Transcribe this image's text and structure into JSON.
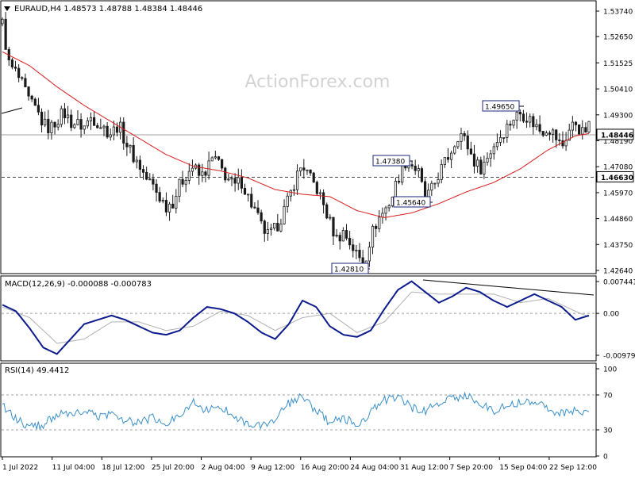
{
  "colors": {
    "candle": "#1a1a1a",
    "sma": "#d81e1e",
    "macd": "#0b1a8c",
    "signal": "#b0b0b0",
    "rsi": "#3a8fc8",
    "grid": "#a0a0a0",
    "label_border": "#1a237e",
    "price_box": "#ffffff"
  },
  "panels": {
    "main": {
      "header": "EURAUD,H4  1.48573 1.48788 1.48384 1.48446",
      "watermark": "ActionForex.com",
      "y_ticks": [
        "1.53740",
        "1.52650",
        "1.51525",
        "1.50410",
        "1.49300",
        "1.48190",
        "1.47080",
        "1.45970",
        "1.44860",
        "1.43750",
        "1.42640"
      ],
      "current_price": "1.48446",
      "support_level": "1.46630",
      "annotations": [
        "1.49650",
        "1.47380",
        "1.45640",
        "1.42810"
      ]
    },
    "macd": {
      "header": "MACD(12,26,9) -0.000088 -0.000783",
      "y_ticks": [
        "0.007441",
        "0.00",
        "-0.009794"
      ]
    },
    "rsi": {
      "header": "RSI(14) 49.4412",
      "y_ticks": [
        "100",
        "70",
        "30",
        "0"
      ]
    },
    "x_ticks": [
      "1 Jul 2022",
      "11 Jul 04:00",
      "18 Jul 12:00",
      "25 Jul 20:00",
      "2 Aug 04:00",
      "9 Aug 12:00",
      "16 Aug 20:00",
      "24 Aug 04:00",
      "31 Aug 12:00",
      "7 Sep 20:00",
      "15 Sep 04:00",
      "22 Sep 12:00"
    ]
  },
  "chart_data": {
    "type": "candlestick",
    "symbol": "EURAUD",
    "timeframe": "H4",
    "ylim": [
      1.4264,
      1.5374
    ],
    "price_path": [
      [
        0,
        1.532
      ],
      [
        1,
        1.514
      ],
      [
        2,
        1.511
      ],
      [
        3,
        1.505
      ],
      [
        4,
        1.498
      ],
      [
        5,
        1.495
      ],
      [
        6,
        1.489
      ],
      [
        7,
        1.487
      ],
      [
        8,
        1.491
      ],
      [
        9,
        1.494
      ],
      [
        10,
        1.49
      ],
      [
        11,
        1.489
      ],
      [
        12,
        1.488
      ],
      [
        13,
        1.492
      ],
      [
        14,
        1.49
      ],
      [
        15,
        1.487
      ],
      [
        16,
        1.485
      ],
      [
        17,
        1.489
      ],
      [
        18,
        1.482
      ],
      [
        19,
        1.476
      ],
      [
        20,
        1.472
      ],
      [
        21,
        1.466
      ],
      [
        22,
        1.463
      ],
      [
        23,
        1.458
      ],
      [
        24,
        1.454
      ],
      [
        25,
        1.456
      ],
      [
        26,
        1.463
      ],
      [
        27,
        1.468
      ],
      [
        28,
        1.471
      ],
      [
        29,
        1.466
      ],
      [
        30,
        1.47
      ],
      [
        31,
        1.475
      ],
      [
        32,
        1.47
      ],
      [
        33,
        1.466
      ],
      [
        34,
        1.462
      ],
      [
        35,
        1.465
      ],
      [
        36,
        1.458
      ],
      [
        37,
        1.452
      ],
      [
        38,
        1.445
      ],
      [
        39,
        1.441
      ],
      [
        40,
        1.444
      ],
      [
        41,
        1.45
      ],
      [
        42,
        1.457
      ],
      [
        43,
        1.466
      ],
      [
        44,
        1.472
      ],
      [
        45,
        1.466
      ],
      [
        46,
        1.462
      ],
      [
        47,
        1.455
      ],
      [
        48,
        1.447
      ],
      [
        49,
        1.44
      ],
      [
        50,
        1.443
      ],
      [
        51,
        1.438
      ],
      [
        52,
        1.433
      ],
      [
        53,
        1.429
      ],
      [
        54,
        1.441
      ],
      [
        55,
        1.448
      ],
      [
        56,
        1.452
      ],
      [
        57,
        1.457
      ],
      [
        58,
        1.466
      ],
      [
        59,
        1.473
      ],
      [
        60,
        1.472
      ],
      [
        61,
        1.468
      ],
      [
        62,
        1.457
      ],
      [
        63,
        1.461
      ],
      [
        64,
        1.468
      ],
      [
        65,
        1.473
      ],
      [
        66,
        1.479
      ],
      [
        67,
        1.486
      ],
      [
        68,
        1.481
      ],
      [
        69,
        1.474
      ],
      [
        70,
        1.47
      ],
      [
        71,
        1.474
      ],
      [
        72,
        1.48
      ],
      [
        73,
        1.484
      ],
      [
        74,
        1.488
      ],
      [
        75,
        1.492
      ],
      [
        76,
        1.494
      ],
      [
        77,
        1.492
      ],
      [
        78,
        1.489
      ],
      [
        79,
        1.486
      ],
      [
        80,
        1.488
      ],
      [
        81,
        1.484
      ],
      [
        82,
        1.479
      ],
      [
        83,
        1.486
      ],
      [
        84,
        1.49
      ],
      [
        85,
        1.485
      ],
      [
        86,
        1.488
      ]
    ],
    "sma_path": [
      [
        0,
        1.52
      ],
      [
        4,
        1.514
      ],
      [
        8,
        1.505
      ],
      [
        12,
        1.497
      ],
      [
        16,
        1.49
      ],
      [
        20,
        1.483
      ],
      [
        24,
        1.476
      ],
      [
        28,
        1.471
      ],
      [
        32,
        1.469
      ],
      [
        36,
        1.466
      ],
      [
        40,
        1.461
      ],
      [
        44,
        1.459
      ],
      [
        48,
        1.458
      ],
      [
        52,
        1.452
      ],
      [
        56,
        1.449
      ],
      [
        60,
        1.451
      ],
      [
        64,
        1.455
      ],
      [
        68,
        1.46
      ],
      [
        72,
        1.464
      ],
      [
        76,
        1.47
      ],
      [
        80,
        1.478
      ],
      [
        84,
        1.484
      ],
      [
        86,
        1.485
      ]
    ],
    "macd_path": [
      [
        0,
        0.002
      ],
      [
        2,
        0.0005
      ],
      [
        4,
        -0.0035
      ],
      [
        6,
        -0.008
      ],
      [
        8,
        -0.0095
      ],
      [
        10,
        -0.006
      ],
      [
        12,
        -0.0025
      ],
      [
        14,
        -0.0015
      ],
      [
        16,
        -0.0005
      ],
      [
        18,
        -0.0015
      ],
      [
        20,
        -0.003
      ],
      [
        22,
        -0.0045
      ],
      [
        24,
        -0.005
      ],
      [
        26,
        -0.004
      ],
      [
        28,
        -0.001
      ],
      [
        30,
        0.0015
      ],
      [
        32,
        0.001
      ],
      [
        34,
        0.0
      ],
      [
        36,
        -0.002
      ],
      [
        38,
        -0.0045
      ],
      [
        40,
        -0.006
      ],
      [
        42,
        -0.0025
      ],
      [
        44,
        0.003
      ],
      [
        46,
        0.0015
      ],
      [
        48,
        -0.003
      ],
      [
        50,
        -0.005
      ],
      [
        52,
        -0.0055
      ],
      [
        54,
        -0.004
      ],
      [
        56,
        0.001
      ],
      [
        58,
        0.0055
      ],
      [
        60,
        0.0075
      ],
      [
        62,
        0.005
      ],
      [
        64,
        0.0025
      ],
      [
        66,
        0.004
      ],
      [
        68,
        0.006
      ],
      [
        70,
        0.005
      ],
      [
        72,
        0.003
      ],
      [
        74,
        0.0015
      ],
      [
        76,
        0.003
      ],
      [
        78,
        0.0045
      ],
      [
        80,
        0.003
      ],
      [
        82,
        0.0015
      ],
      [
        84,
        -0.0015
      ],
      [
        86,
        -0.0005
      ]
    ],
    "signal_path": [
      [
        0,
        0.0015
      ],
      [
        4,
        -0.001
      ],
      [
        8,
        -0.007
      ],
      [
        12,
        -0.006
      ],
      [
        16,
        -0.002
      ],
      [
        20,
        -0.002
      ],
      [
        24,
        -0.004
      ],
      [
        28,
        -0.003
      ],
      [
        32,
        0.0005
      ],
      [
        36,
        -0.0005
      ],
      [
        40,
        -0.004
      ],
      [
        44,
        -0.001
      ],
      [
        48,
        0.0
      ],
      [
        52,
        -0.0045
      ],
      [
        56,
        -0.002
      ],
      [
        60,
        0.005
      ],
      [
        64,
        0.0045
      ],
      [
        68,
        0.0045
      ],
      [
        72,
        0.0045
      ],
      [
        76,
        0.0025
      ],
      [
        80,
        0.0035
      ],
      [
        84,
        0.0005
      ],
      [
        86,
        -0.0008
      ]
    ],
    "rsi_path": [
      [
        0,
        58
      ],
      [
        2,
        42
      ],
      [
        4,
        33
      ],
      [
        6,
        36
      ],
      [
        8,
        48
      ],
      [
        10,
        46
      ],
      [
        12,
        52
      ],
      [
        14,
        45
      ],
      [
        16,
        49
      ],
      [
        18,
        40
      ],
      [
        20,
        38
      ],
      [
        22,
        44
      ],
      [
        24,
        35
      ],
      [
        26,
        48
      ],
      [
        28,
        62
      ],
      [
        30,
        52
      ],
      [
        32,
        56
      ],
      [
        34,
        47
      ],
      [
        36,
        36
      ],
      [
        38,
        34
      ],
      [
        40,
        42
      ],
      [
        42,
        60
      ],
      [
        44,
        68
      ],
      [
        46,
        52
      ],
      [
        48,
        38
      ],
      [
        50,
        44
      ],
      [
        52,
        35
      ],
      [
        54,
        50
      ],
      [
        56,
        64
      ],
      [
        58,
        68
      ],
      [
        60,
        55
      ],
      [
        62,
        52
      ],
      [
        64,
        60
      ],
      [
        66,
        66
      ],
      [
        68,
        70
      ],
      [
        70,
        60
      ],
      [
        72,
        52
      ],
      [
        74,
        58
      ],
      [
        76,
        62
      ],
      [
        78,
        64
      ],
      [
        80,
        55
      ],
      [
        82,
        48
      ],
      [
        84,
        52
      ],
      [
        86,
        50
      ]
    ]
  }
}
